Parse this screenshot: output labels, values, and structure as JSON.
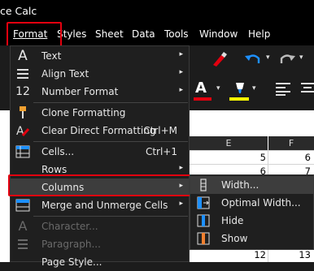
{
  "window": {
    "title": "ce Calc"
  },
  "menubar": {
    "items": [
      "Format",
      "Styles",
      "Sheet",
      "Data",
      "Tools",
      "Window",
      "Help"
    ]
  },
  "format_menu": {
    "items": [
      {
        "label": "Text",
        "icon": "text-icon",
        "submenu": true
      },
      {
        "label": "Align Text",
        "icon": "align-text-icon",
        "submenu": true
      },
      {
        "label": "Number Format",
        "icon": "number-format-icon",
        "submenu": true
      },
      {
        "label": "Clone Formatting",
        "icon": "clone-formatting-icon"
      },
      {
        "label": "Clear Direct Formatting",
        "icon": "clear-formatting-icon",
        "shortcut": "Ctrl+M"
      },
      {
        "label": "Cells...",
        "icon": "cells-icon",
        "shortcut": "Ctrl+1"
      },
      {
        "label": "Rows",
        "submenu": true
      },
      {
        "label": "Columns",
        "submenu": true
      },
      {
        "label": "Merge and Unmerge Cells",
        "icon": "merge-cells-icon",
        "submenu": true
      },
      {
        "label": "Character...",
        "icon": "character-icon",
        "disabled": true
      },
      {
        "label": "Paragraph...",
        "icon": "paragraph-icon",
        "disabled": true
      },
      {
        "label": "Page Style..."
      }
    ]
  },
  "columns_submenu": {
    "items": [
      {
        "label": "Width...",
        "icon": "column-width-icon"
      },
      {
        "label": "Optimal Width...",
        "icon": "optimal-width-icon"
      },
      {
        "label": "Hide",
        "icon": "hide-column-icon"
      },
      {
        "label": "Show",
        "icon": "show-column-icon"
      }
    ]
  },
  "sheet": {
    "columns": [
      "E",
      "F"
    ],
    "rows": [
      [
        "5",
        "6"
      ],
      [
        "6",
        "7"
      ],
      [
        "12",
        "13"
      ]
    ]
  },
  "colors": {
    "highlight_border": "#e3000f",
    "font_color_bar": "#e3000f",
    "highlight_bar": "#ffff00"
  }
}
